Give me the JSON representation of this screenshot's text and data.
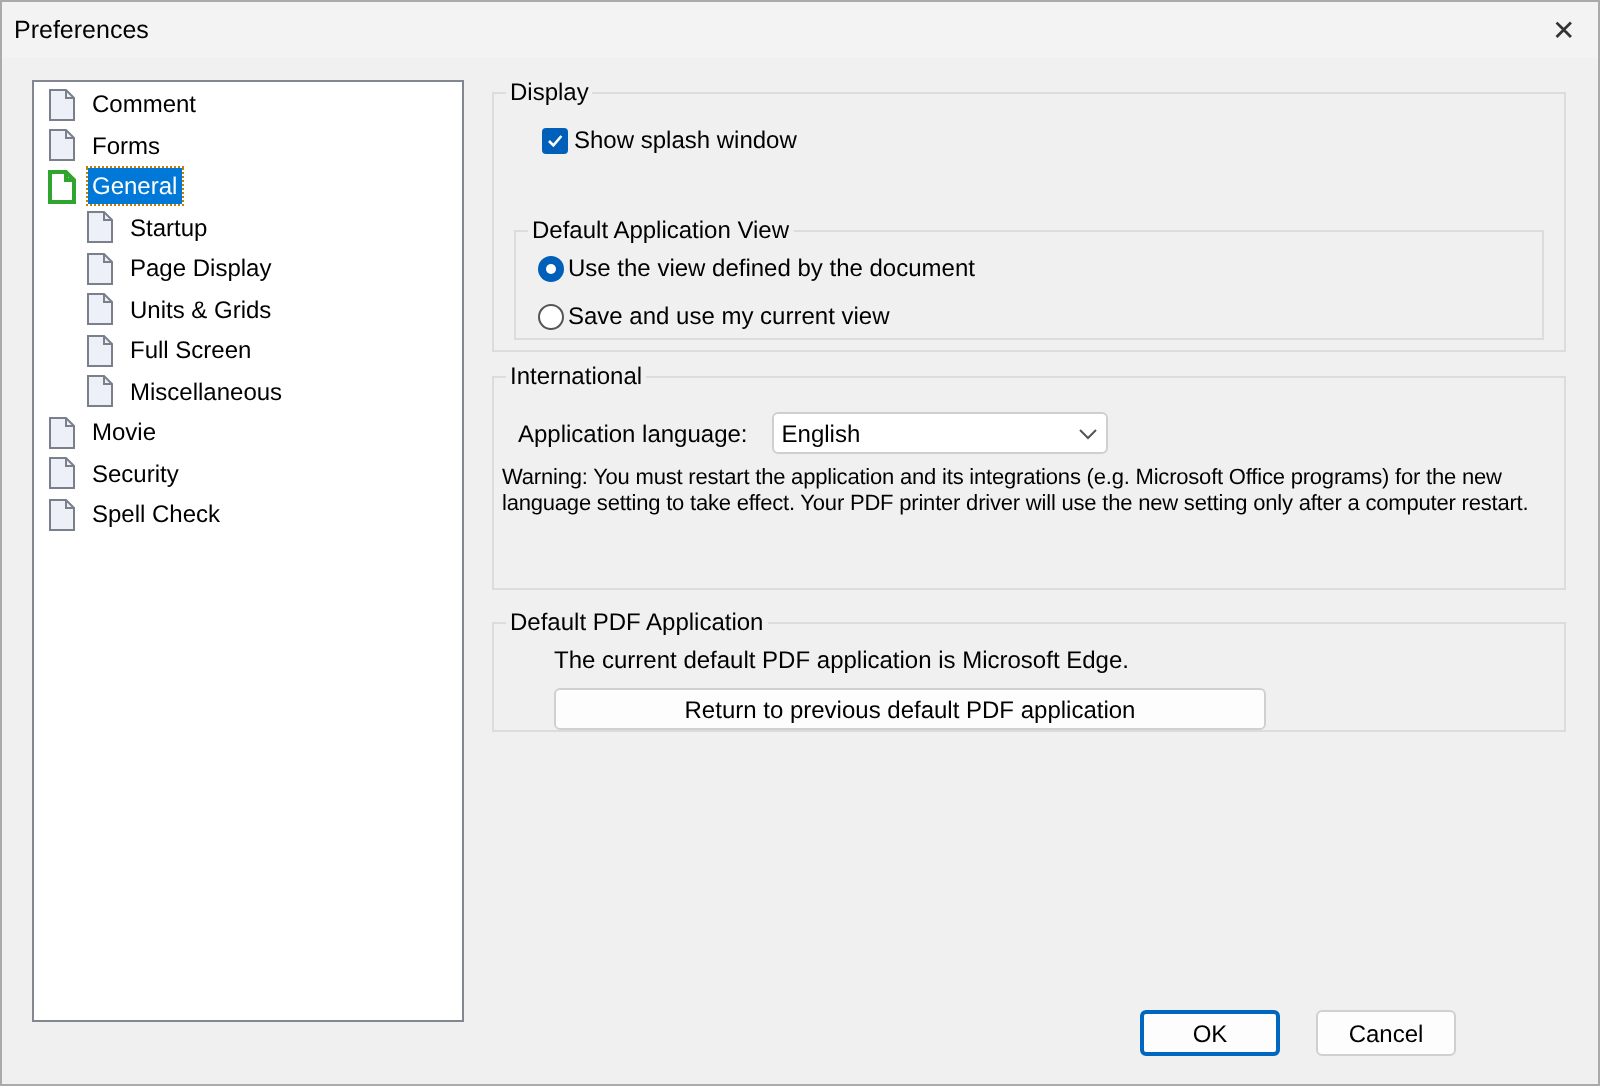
{
  "window": {
    "title": "Preferences",
    "close": "✕"
  },
  "tree": [
    {
      "label": "Comment",
      "selected": false
    },
    {
      "label": "Forms",
      "selected": false
    },
    {
      "label": "General",
      "selected": true,
      "children": [
        {
          "label": "Startup",
          "selected": false
        },
        {
          "label": "Page Display",
          "selected": false
        },
        {
          "label": "Units & Grids",
          "selected": false
        },
        {
          "label": "Full Screen",
          "selected": false
        },
        {
          "label": "Miscellaneous",
          "selected": false
        }
      ]
    },
    {
      "label": "Movie",
      "selected": false
    },
    {
      "label": "Security",
      "selected": false
    },
    {
      "label": "Spell Check",
      "selected": false
    }
  ],
  "display": {
    "title": "Display",
    "show_splash": {
      "label": "Show splash window",
      "checked": true
    },
    "default_view": {
      "title": "Default Application View",
      "options": [
        {
          "label": "Use the view defined by the document",
          "selected": true
        },
        {
          "label": "Save and use my current view",
          "selected": false
        }
      ]
    }
  },
  "international": {
    "title": "International",
    "language_label": "Application language:",
    "language_value": "English",
    "warning": "Warning: You must restart the application and its integrations (e.g. Microsoft Office programs) for the new language setting to take effect. Your PDF printer driver will use the new setting only after a computer restart."
  },
  "default_pdf": {
    "title": "Default PDF Application",
    "message": "The current default PDF application is Microsoft Edge.",
    "button": "Return to previous default PDF application"
  },
  "buttons": [
    "OK",
    "Cancel"
  ]
}
